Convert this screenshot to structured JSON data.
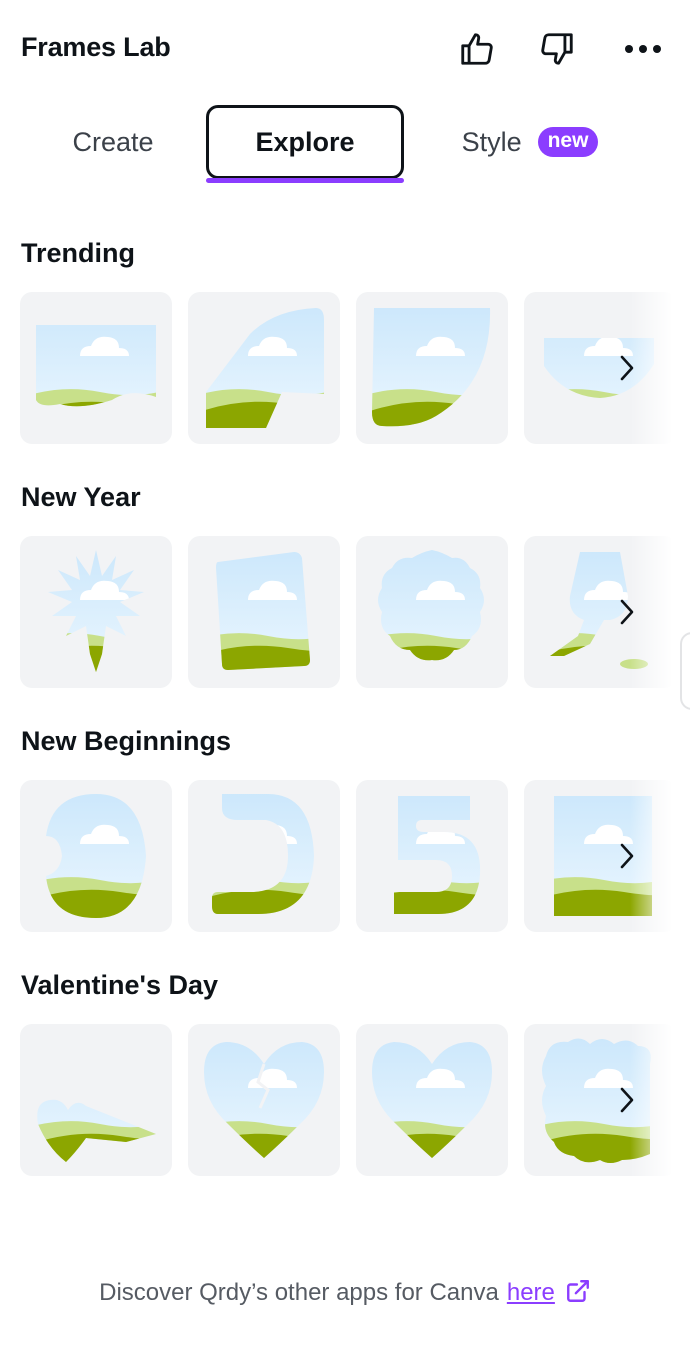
{
  "header": {
    "title": "Frames Lab",
    "like_icon": "thumbs-up-icon",
    "dislike_icon": "thumbs-down-icon",
    "more_icon": "more-dots-icon"
  },
  "tabs": [
    {
      "label": "Create",
      "active": false
    },
    {
      "label": "Explore",
      "active": true
    },
    {
      "label": "Style",
      "active": false,
      "badge": "new"
    }
  ],
  "sections": [
    {
      "title": "Trending",
      "frames": [
        "banner-frame",
        "curved-wedge-frame",
        "leaf-frame",
        "wave-frame"
      ]
    },
    {
      "title": "New Year",
      "frames": [
        "firework-frame",
        "tilted-card-frame",
        "wavy-circle-frame",
        "champagne-glasses-frame"
      ]
    },
    {
      "title": "New Beginnings",
      "frames": [
        "number-0-frame",
        "number-2-frame",
        "number-5-frame",
        "number-frame"
      ]
    },
    {
      "title": "Valentine's Day",
      "frames": [
        "heart-arrow-frame",
        "broken-heart-frame",
        "heart-frame",
        "lace-heart-frame"
      ]
    }
  ],
  "footer": {
    "text": "Discover Qrdy’s other apps for Canva",
    "link": "here",
    "link_icon": "external-link-icon"
  },
  "colors": {
    "accent": "#8b3dff",
    "sky": "#cfe9fb",
    "hill_light": "#c8e08a",
    "hill_dark": "#8ca600",
    "tile_bg": "#f2f3f5"
  }
}
